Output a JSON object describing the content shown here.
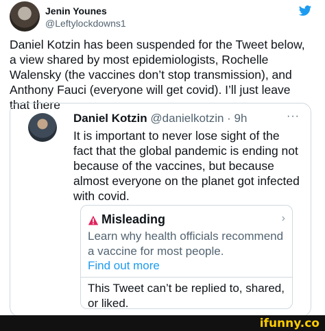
{
  "author": {
    "name": "Jenin Younes",
    "handle": "@Leftylockdowns1"
  },
  "tweet_text": "Daniel Kotzin has been suspended for the Tweet below, a view shared by most epidemiologists, Rochelle Walensky (the vaccines don’t stop transmission), and Anthony Fauci (everyone will get covid). I’ll just leave that there",
  "quoted": {
    "name": "Daniel Kotzin",
    "handle_time": "@danielkotzin · 9h",
    "more": "···",
    "text": "It is important to never lose sight of the fact that the global pandemic is ending not because of the vaccines, but because almost everyone on the planet got infected with covid.",
    "warning": {
      "title": "Misleading",
      "body": "Learn why health officials recommend a vaccine for most people.",
      "link": "Find out more",
      "footer": "This Tweet can’t be replied to, shared, or liked."
    }
  },
  "watermark": "ifunny.co",
  "colors": {
    "accent": "#1d9bf0",
    "warning": "#e0245e"
  }
}
